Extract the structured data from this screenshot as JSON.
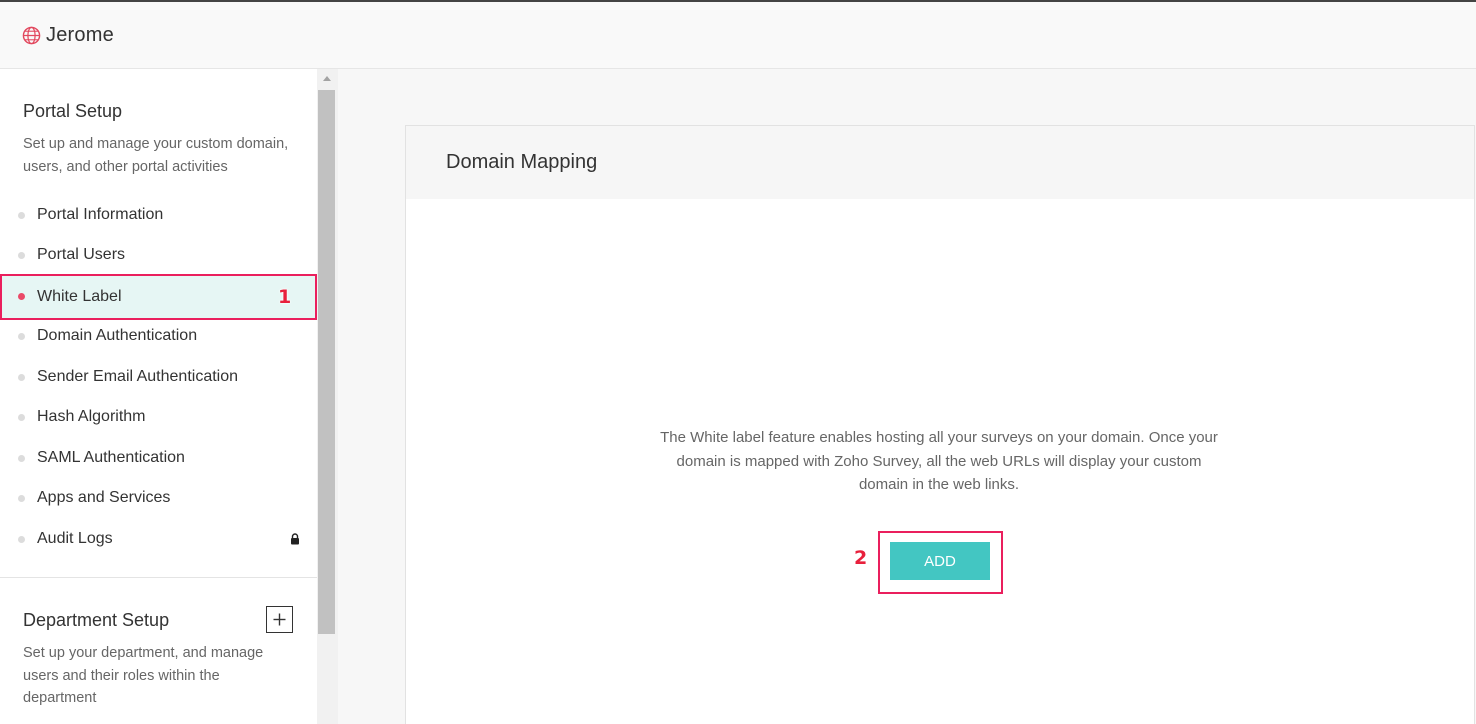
{
  "header": {
    "org_name": "Jerome",
    "icon": "globe-icon"
  },
  "sidebar": {
    "portal_setup": {
      "title": "Portal Setup",
      "description": "Set up and manage your custom domain, users, and other portal activities"
    },
    "items": [
      {
        "label": "Portal Information"
      },
      {
        "label": "Portal Users"
      },
      {
        "label": "White Label",
        "active": true,
        "marker": "1"
      },
      {
        "label": "Domain Authentication"
      },
      {
        "label": "Sender Email Authentication"
      },
      {
        "label": "Hash Algorithm"
      },
      {
        "label": "SAML Authentication"
      },
      {
        "label": "Apps and Services"
      },
      {
        "label": "Audit Logs",
        "locked": true
      }
    ],
    "department_setup": {
      "title": "Department Setup",
      "description": "Set up your department, and manage users and their roles within the department"
    }
  },
  "main": {
    "card_title": "Domain Mapping",
    "description": "The White label feature enables hosting all your surveys on your domain. Once your domain is mapped with Zoho Survey, all the web URLs will display your custom domain in the web links.",
    "add_label": "ADD",
    "add_marker": "2"
  },
  "colors": {
    "accent": "#43c6c2",
    "highlight": "#ea1f5d",
    "active_bg": "#e6f6f4"
  }
}
